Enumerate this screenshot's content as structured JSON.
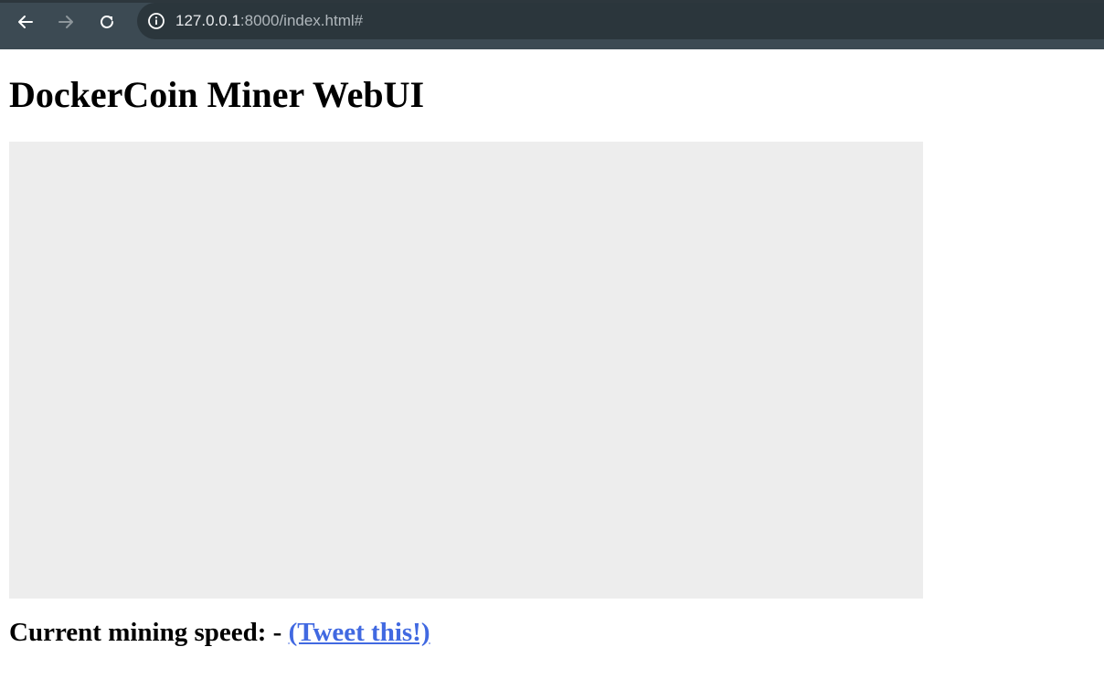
{
  "browser": {
    "url_host": "127.0.0.1",
    "url_rest": ":8000/index.html#",
    "icons": {
      "back": "back-arrow-icon",
      "forward": "forward-arrow-icon",
      "reload": "reload-icon",
      "site_info": "info-icon"
    }
  },
  "page": {
    "title": "DockerCoin Miner WebUI",
    "speed_label": "Current mining speed:",
    "speed_value": "-",
    "tweet_link": "(Tweet this!)"
  },
  "colors": {
    "toolbar": "#3c4a53",
    "url_box": "#2b363c",
    "graph_background": "#ededed",
    "link": "#4169e1"
  }
}
